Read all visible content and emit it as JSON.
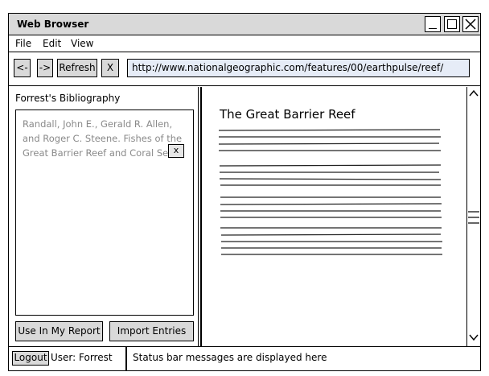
{
  "window": {
    "title": "Web Browser"
  },
  "menu": {
    "items": [
      "File",
      "Edit",
      "View"
    ]
  },
  "toolbar": {
    "back_label": "<-",
    "forward_label": "->",
    "refresh_label": "Refresh",
    "stop_label": "X",
    "url": "http://www.nationalgeographic.com/features/00/earthpulse/reef/"
  },
  "bibliography": {
    "title": "Forrest's Bibliography",
    "entries": [
      {
        "text": "Randall, John E., Gerald R. Allen, and Roger C. Steene. Fishes of the Great Barrier Reef and Coral Sea.",
        "remove_label": "x"
      }
    ],
    "use_button_label": "Use In My Report",
    "import_button_label": "Import Entries"
  },
  "content": {
    "page_title": "The Great Barrier Reef"
  },
  "statusbar": {
    "logout_label": "Logout",
    "user_text": "User: Forrest",
    "message": "Status bar messages are displayed here"
  }
}
